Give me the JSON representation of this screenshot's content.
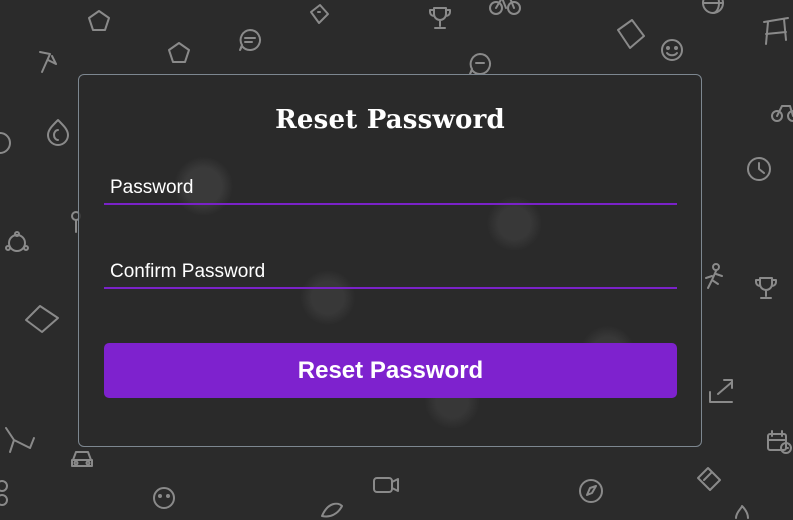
{
  "form": {
    "title": "Reset Password",
    "password_placeholder": "Password",
    "confirm_placeholder": "Confirm Password",
    "submit_label": "Reset Password"
  },
  "colors": {
    "background": "#2b2b2b",
    "accent": "#7e22ce",
    "card_border": "#7d8790",
    "text": "#ffffff",
    "pattern_icon": "#8a8a8a"
  },
  "background_icons": [
    "pentagon-icon",
    "star-icon",
    "trophy-icon",
    "chat-bubble-icon",
    "emoji-icon",
    "clock-icon",
    "hexagon-network-icon",
    "diamond-icon",
    "share-arrow-icon",
    "calendar-clock-icon",
    "car-icon",
    "camera-icon",
    "bicycle-icon",
    "person-icon",
    "flame-icon",
    "chair-icon"
  ]
}
